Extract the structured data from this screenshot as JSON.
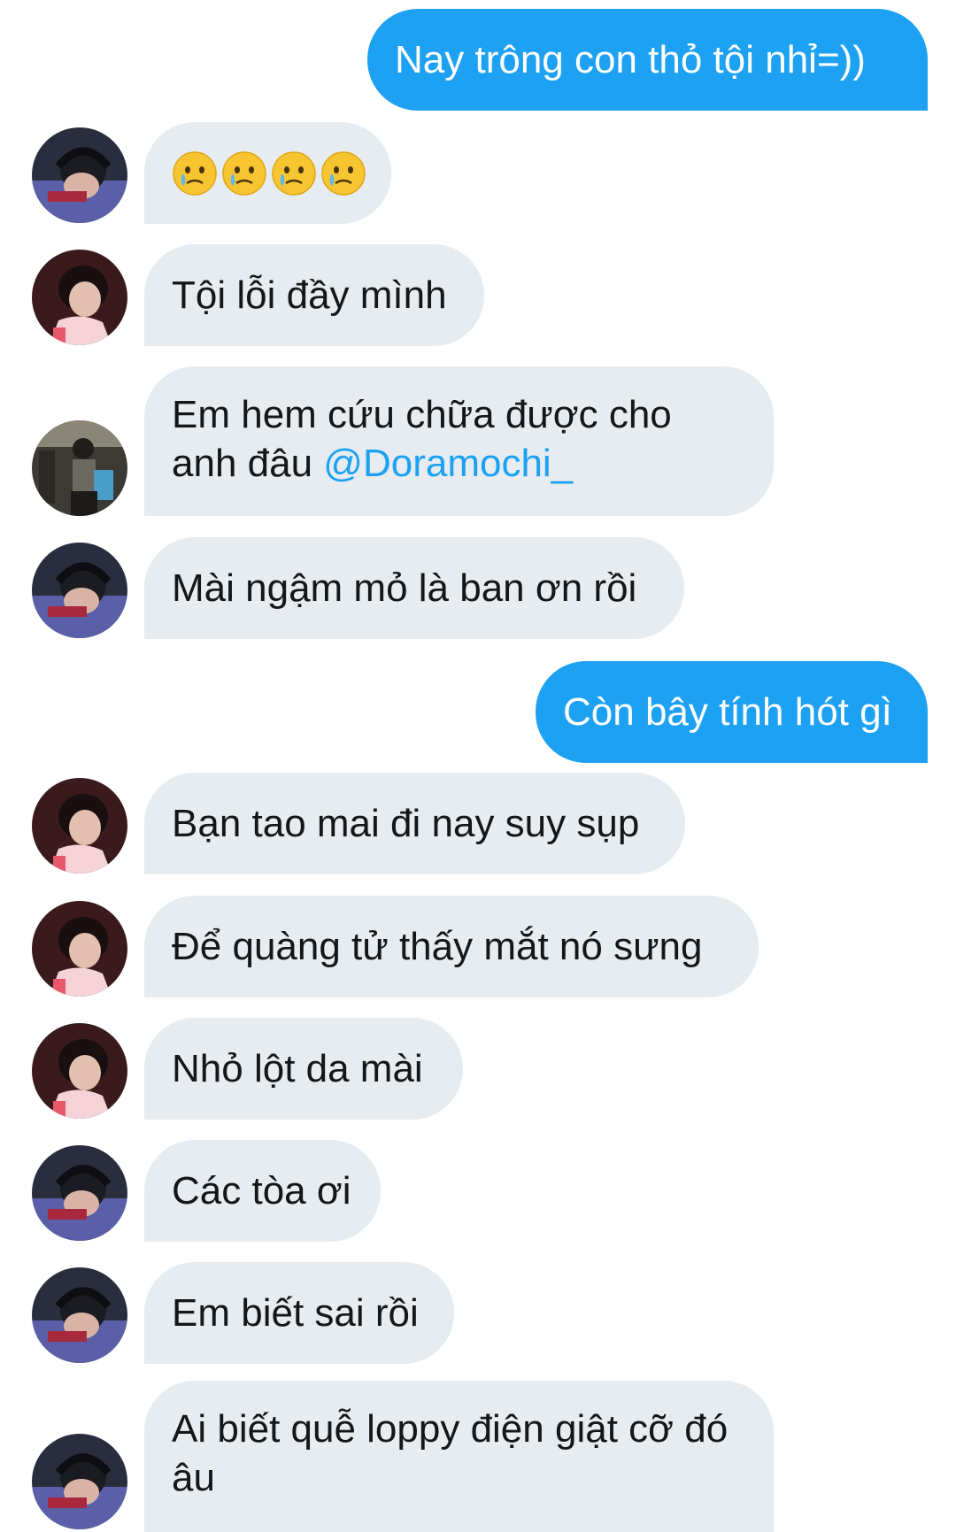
{
  "messages": [
    {
      "side": "out",
      "text": "Nay trông con thỏ tội nhỉ=))"
    },
    {
      "side": "in",
      "avatar": "avatar-a-headphones",
      "emoji": [
        "crying-face-emoji",
        "crying-face-emoji",
        "crying-face-emoji",
        "crying-face-emoji"
      ]
    },
    {
      "side": "in",
      "avatar": "avatar-b-dark-hair",
      "text": "Tội lỗi đầy mình"
    },
    {
      "side": "in",
      "avatar": "avatar-c-gym",
      "text_prefix": "Em hem cứu chữa được cho anh đâu",
      "mention": "@Doramochi_"
    },
    {
      "side": "in",
      "avatar": "avatar-a-headphones",
      "text": "Mài ngậm mỏ là ban ơn rồi"
    },
    {
      "side": "out",
      "text": "Còn bây tính hót gì"
    },
    {
      "side": "in",
      "avatar": "avatar-b-dark-hair",
      "text": "Bạn tao mai đi nay suy sụp"
    },
    {
      "side": "in",
      "avatar": "avatar-b-dark-hair",
      "text": "Để quàng tử thấy mắt nó sưng"
    },
    {
      "side": "in",
      "avatar": "avatar-b-dark-hair",
      "text": "Nhỏ lột da mài"
    },
    {
      "side": "in",
      "avatar": "avatar-a-headphones",
      "text": "Các tòa ơi"
    },
    {
      "side": "in",
      "avatar": "avatar-a-headphones",
      "text": "Em biết sai rồi"
    },
    {
      "side": "in",
      "avatar": "avatar-a-headphones",
      "text": "Ai biết quễ loppy điện giật cỡ đó âu"
    }
  ],
  "colors": {
    "outgoing_bubble": "#1da1f2",
    "incoming_bubble": "#e6ecf0",
    "mention": "#1da1f2",
    "text_dark": "#14171a"
  }
}
